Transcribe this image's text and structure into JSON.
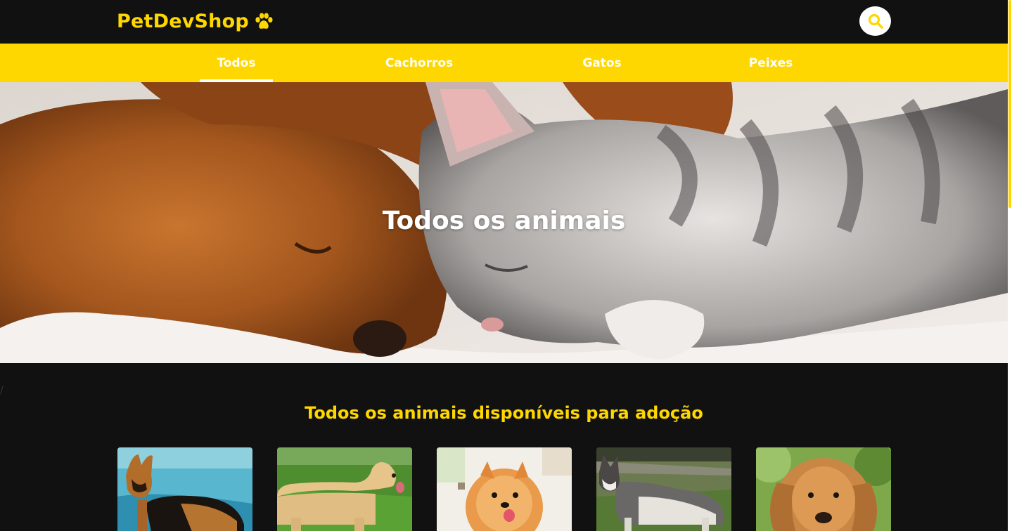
{
  "brand": {
    "name": "PetDevShop",
    "icon": "paw-icon",
    "color": "#FFD700"
  },
  "header": {
    "search_icon": "search-icon"
  },
  "nav": {
    "items": [
      {
        "label": "Todos",
        "active": true
      },
      {
        "label": "Cachorros",
        "active": false
      },
      {
        "label": "Gatos",
        "active": false
      },
      {
        "label": "Peixes",
        "active": false
      }
    ]
  },
  "hero": {
    "title": "Todos os animais"
  },
  "stray_char": "/",
  "section": {
    "title": "Todos os animais disponíveis para adoção"
  },
  "cards": [
    {
      "subject": "german-shepherd-photo"
    },
    {
      "subject": "labrador-photo"
    },
    {
      "subject": "pomeranian-photo"
    },
    {
      "subject": "husky-photo"
    },
    {
      "subject": "golden-retriever-photo"
    }
  ],
  "colors": {
    "accent": "#FFD700",
    "background": "#111111",
    "text_light": "#ffffff"
  }
}
